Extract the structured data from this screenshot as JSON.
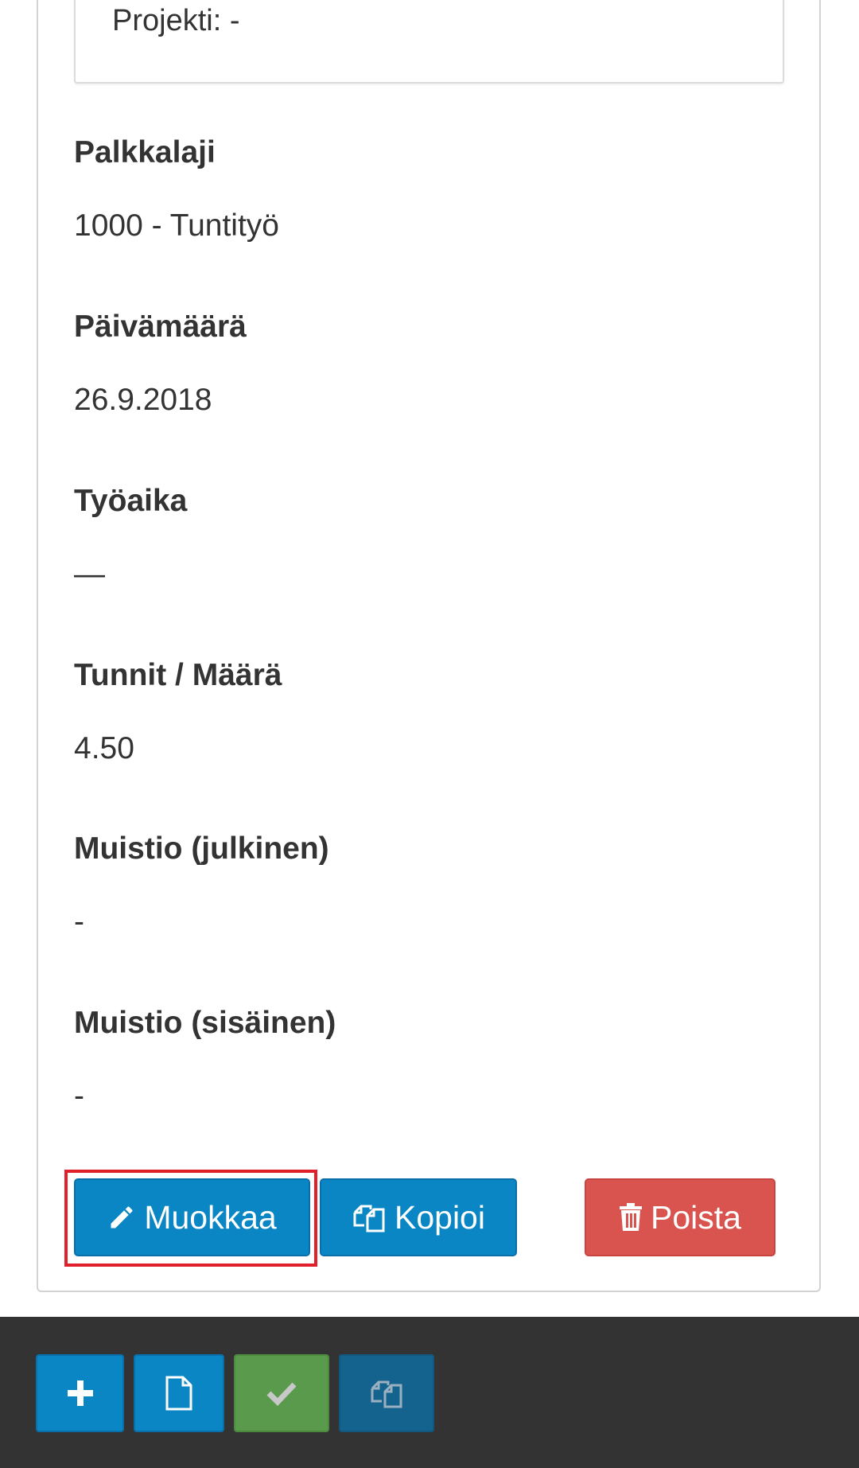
{
  "project": {
    "line": "Projekti: -"
  },
  "fields": [
    {
      "label": "Palkkalaji",
      "value": "1000 - Tuntityö"
    },
    {
      "label": "Päivämäärä",
      "value": "26.9.2018"
    },
    {
      "label": "Työaika",
      "value": "—"
    },
    {
      "label": "Tunnit / Määrä",
      "value": "4.50"
    },
    {
      "label": "Muistio (julkinen)",
      "value": "-"
    },
    {
      "label": "Muistio (sisäinen)",
      "value": "-"
    }
  ],
  "actions": {
    "edit_label": "Muokkaa",
    "copy_label": "Kopioi",
    "delete_label": "Poista"
  },
  "icons": {
    "edit": "pencil-icon",
    "copy": "copy-icon",
    "delete": "trash-icon",
    "add": "plus-icon",
    "document": "document-icon",
    "approve": "checkmark-icon",
    "duplicate": "copy-icon"
  },
  "colors": {
    "primary": "#0a86c5",
    "danger": "#d9534f",
    "success": "#5a9a4d",
    "highlight": "#e0202b",
    "toolbar_bg": "#333333"
  }
}
